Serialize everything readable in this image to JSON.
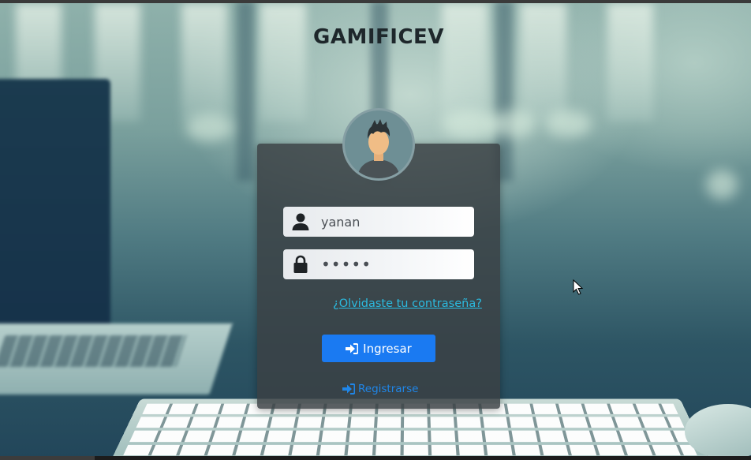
{
  "app_title": "GAMIFICEV",
  "login": {
    "username_value": "yanan",
    "password_value": "•••••",
    "forgot_link": "¿Olvidaste tu contraseña?",
    "submit_label": "Ingresar",
    "register_label": "Registrarse"
  },
  "icons": {
    "avatar": "user-avatar-icon",
    "username": "user-icon",
    "password": "lock-icon",
    "submit": "sign-in-icon",
    "register": "sign-in-icon"
  },
  "colors": {
    "primary_button": "#1a7af2",
    "link": "#2bbbe0",
    "register_link": "#1f86e8",
    "card": "#3a4044"
  }
}
